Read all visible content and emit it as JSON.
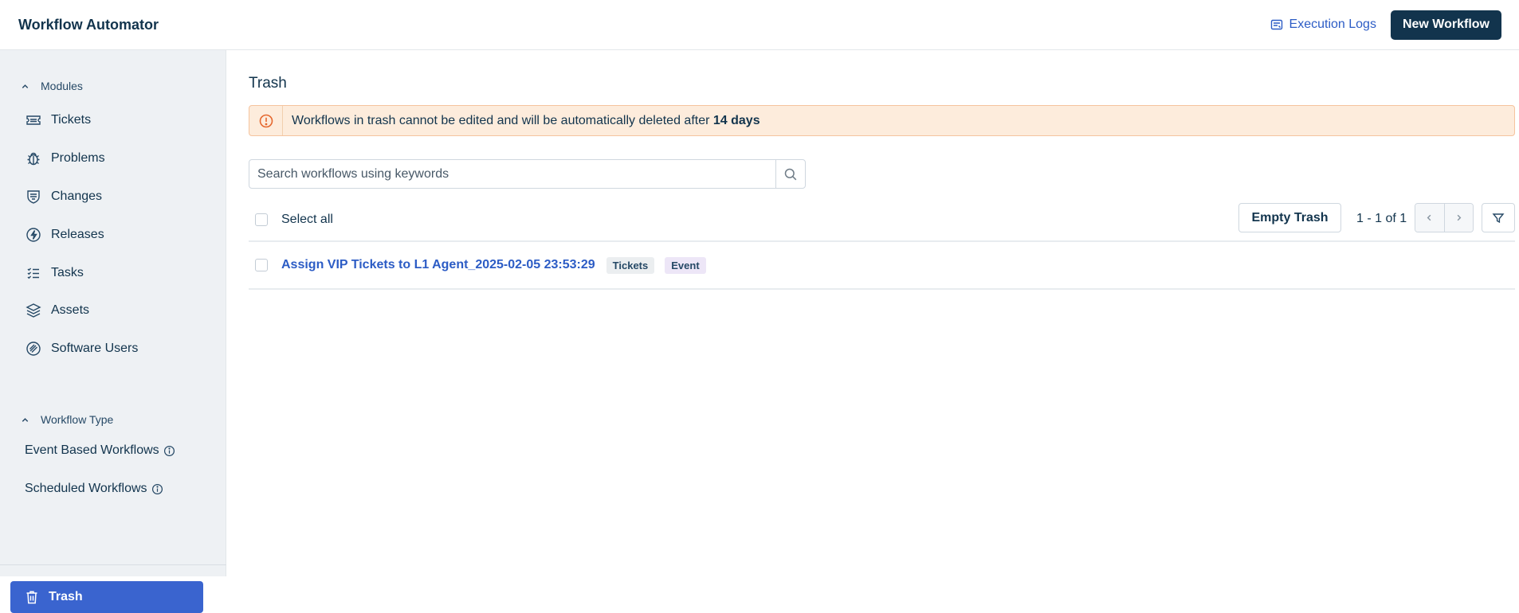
{
  "header": {
    "title": "Workflow Automator",
    "execution_logs": "Execution Logs",
    "new_workflow": "New Workflow"
  },
  "sidebar": {
    "modules_label": "Modules",
    "modules": [
      {
        "label": "Tickets",
        "icon": "ticket-icon"
      },
      {
        "label": "Problems",
        "icon": "bug-icon"
      },
      {
        "label": "Changes",
        "icon": "changes-icon"
      },
      {
        "label": "Releases",
        "icon": "releases-icon"
      },
      {
        "label": "Tasks",
        "icon": "tasks-icon"
      },
      {
        "label": "Assets",
        "icon": "layers-icon"
      },
      {
        "label": "Software Users",
        "icon": "software-icon"
      }
    ],
    "workflow_type_label": "Workflow Type",
    "workflow_types": [
      {
        "label": "Event Based Workflows"
      },
      {
        "label": "Scheduled Workflows"
      }
    ],
    "trash_label": "Trash"
  },
  "main": {
    "title": "Trash",
    "banner": {
      "text": "Workflows in trash cannot be edited and will be automatically deleted after ",
      "bold": "14 days"
    },
    "search_placeholder": "Search workflows using keywords",
    "select_all": "Select all",
    "empty_trash": "Empty Trash",
    "pagination": "1 - 1 of 1",
    "rows": [
      {
        "name": "Assign VIP Tickets to L1 Agent_2025-02-05 23:53:29",
        "tags": [
          "Tickets",
          "Event"
        ]
      }
    ]
  },
  "colors": {
    "primary_dark": "#12344d",
    "link_blue": "#2c5cc5",
    "active_nav": "#3a64cf",
    "banner_bg": "#fdecdc",
    "banner_icon": "#e5672e"
  }
}
